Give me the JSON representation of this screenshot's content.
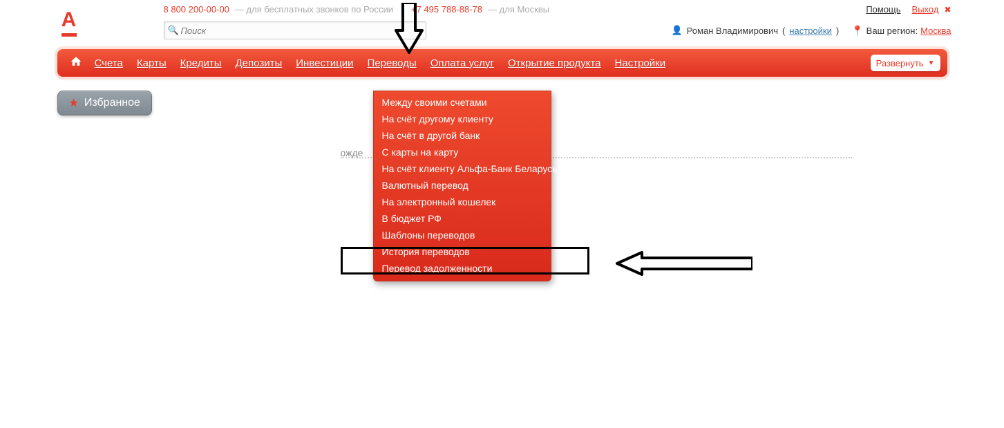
{
  "top": {
    "phone1": "8 800 200-00-00",
    "phone1_note": "— для бесплатных звонков по России",
    "phone2": "+7 495 788-88-78",
    "phone2_note": "— для Москвы",
    "help": "Помощь",
    "exit": "Выход"
  },
  "search": {
    "placeholder": "Поиск"
  },
  "user": {
    "name": "Роман Владимирович",
    "settings": "настройки",
    "region_label": "Ваш регион:",
    "region_value": "Москва"
  },
  "nav": {
    "items": [
      "Счета",
      "Карты",
      "Кредиты",
      "Депозиты",
      "Инвестиции",
      "Переводы",
      "Оплата услуг",
      "Открытие продукта",
      "Настройки"
    ],
    "expand": "Развернуть"
  },
  "dropdown": {
    "items": [
      "Между своими счетами",
      "На счёт другому клиенту",
      "На счёт в другой банк",
      "С карты на карту",
      "На счёт клиенту Альфа-Банк Беларусь",
      "Валютный перевод",
      "На электронный кошелек",
      "В бюджет РФ",
      "Шаблоны переводов",
      "История переводов",
      "Перевод задолженности"
    ]
  },
  "fav": {
    "label": "Избранное"
  },
  "content": {
    "wait_fragment": "ожде"
  }
}
